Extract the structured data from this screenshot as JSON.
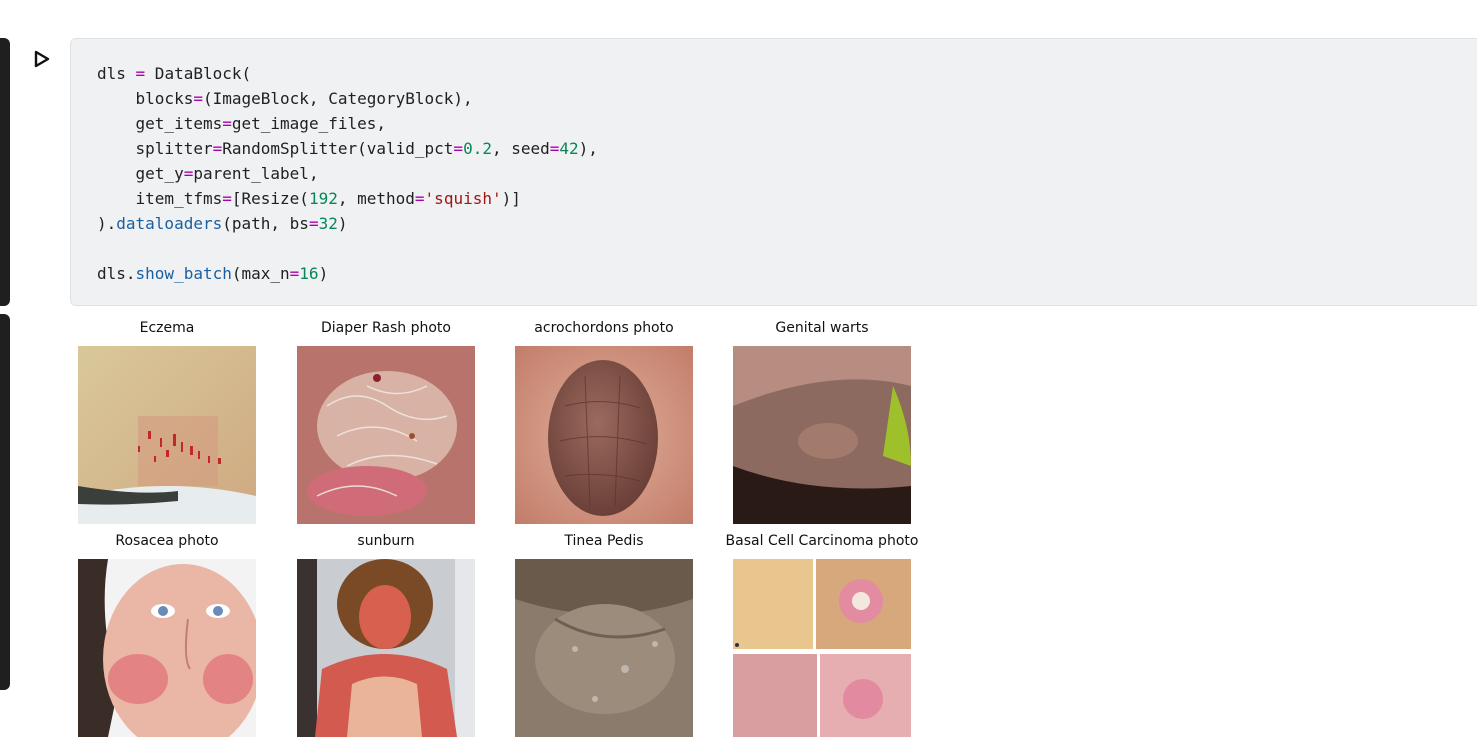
{
  "code_cell": {
    "lines": [
      [
        [
          "dls ",
          ""
        ],
        [
          "=",
          "kw"
        ],
        [
          " DataBlock(",
          ""
        ]
      ],
      [
        [
          "    blocks",
          ""
        ],
        [
          "=",
          "kw"
        ],
        [
          "(ImageBlock, CategoryBlock),",
          ""
        ]
      ],
      [
        [
          "    get_items",
          ""
        ],
        [
          "=",
          "kw"
        ],
        [
          "get_image_files,",
          ""
        ]
      ],
      [
        [
          "    splitter",
          ""
        ],
        [
          "=",
          "kw"
        ],
        [
          "RandomSplitter(valid_pct",
          ""
        ],
        [
          "=",
          "kw"
        ],
        [
          "0.2",
          "num"
        ],
        [
          ", seed",
          ""
        ],
        [
          "=",
          "kw"
        ],
        [
          "42",
          "num"
        ],
        [
          "),",
          ""
        ]
      ],
      [
        [
          "    get_y",
          ""
        ],
        [
          "=",
          "kw"
        ],
        [
          "parent_label,",
          ""
        ]
      ],
      [
        [
          "    item_tfms",
          ""
        ],
        [
          "=",
          "kw"
        ],
        [
          "[Resize(",
          ""
        ],
        [
          "192",
          "num"
        ],
        [
          ", method",
          ""
        ],
        [
          "=",
          "kw"
        ],
        [
          "'squish'",
          "str"
        ],
        [
          ")]",
          ""
        ]
      ],
      [
        [
          ").",
          ""
        ],
        [
          "dataloaders",
          "fn"
        ],
        [
          "(path, bs",
          ""
        ],
        [
          "=",
          "kw"
        ],
        [
          "32",
          "num"
        ],
        [
          ")",
          ""
        ]
      ],
      [
        [
          "",
          ""
        ]
      ],
      [
        [
          "dls.",
          ""
        ],
        [
          "show_batch",
          "fn"
        ],
        [
          "(max_n",
          ""
        ],
        [
          "=",
          "kw"
        ],
        [
          "16",
          "num"
        ],
        [
          ")",
          ""
        ]
      ]
    ]
  },
  "output": {
    "tiles": [
      {
        "label": "Eczema",
        "icon": "eczema-photo"
      },
      {
        "label": "Diaper Rash photo",
        "icon": "diaper-rash-photo"
      },
      {
        "label": "acrochordons photo",
        "icon": "acrochordons-photo"
      },
      {
        "label": "Genital warts",
        "icon": "genital-warts-photo"
      },
      {
        "label": "Rosacea photo",
        "icon": "rosacea-photo"
      },
      {
        "label": "sunburn",
        "icon": "sunburn-photo"
      },
      {
        "label": "Tinea Pedis",
        "icon": "tinea-pedis-photo"
      },
      {
        "label": "Basal Cell Carcinoma photo",
        "icon": "basal-cell-carcinoma-photo"
      }
    ]
  },
  "colors": {
    "cell_bar": "#1f1f1f",
    "code_bg": "#f0f1f3",
    "operator": "#aa00aa",
    "number": "#098658",
    "string": "#a31515",
    "method": "#1a5fa0"
  }
}
